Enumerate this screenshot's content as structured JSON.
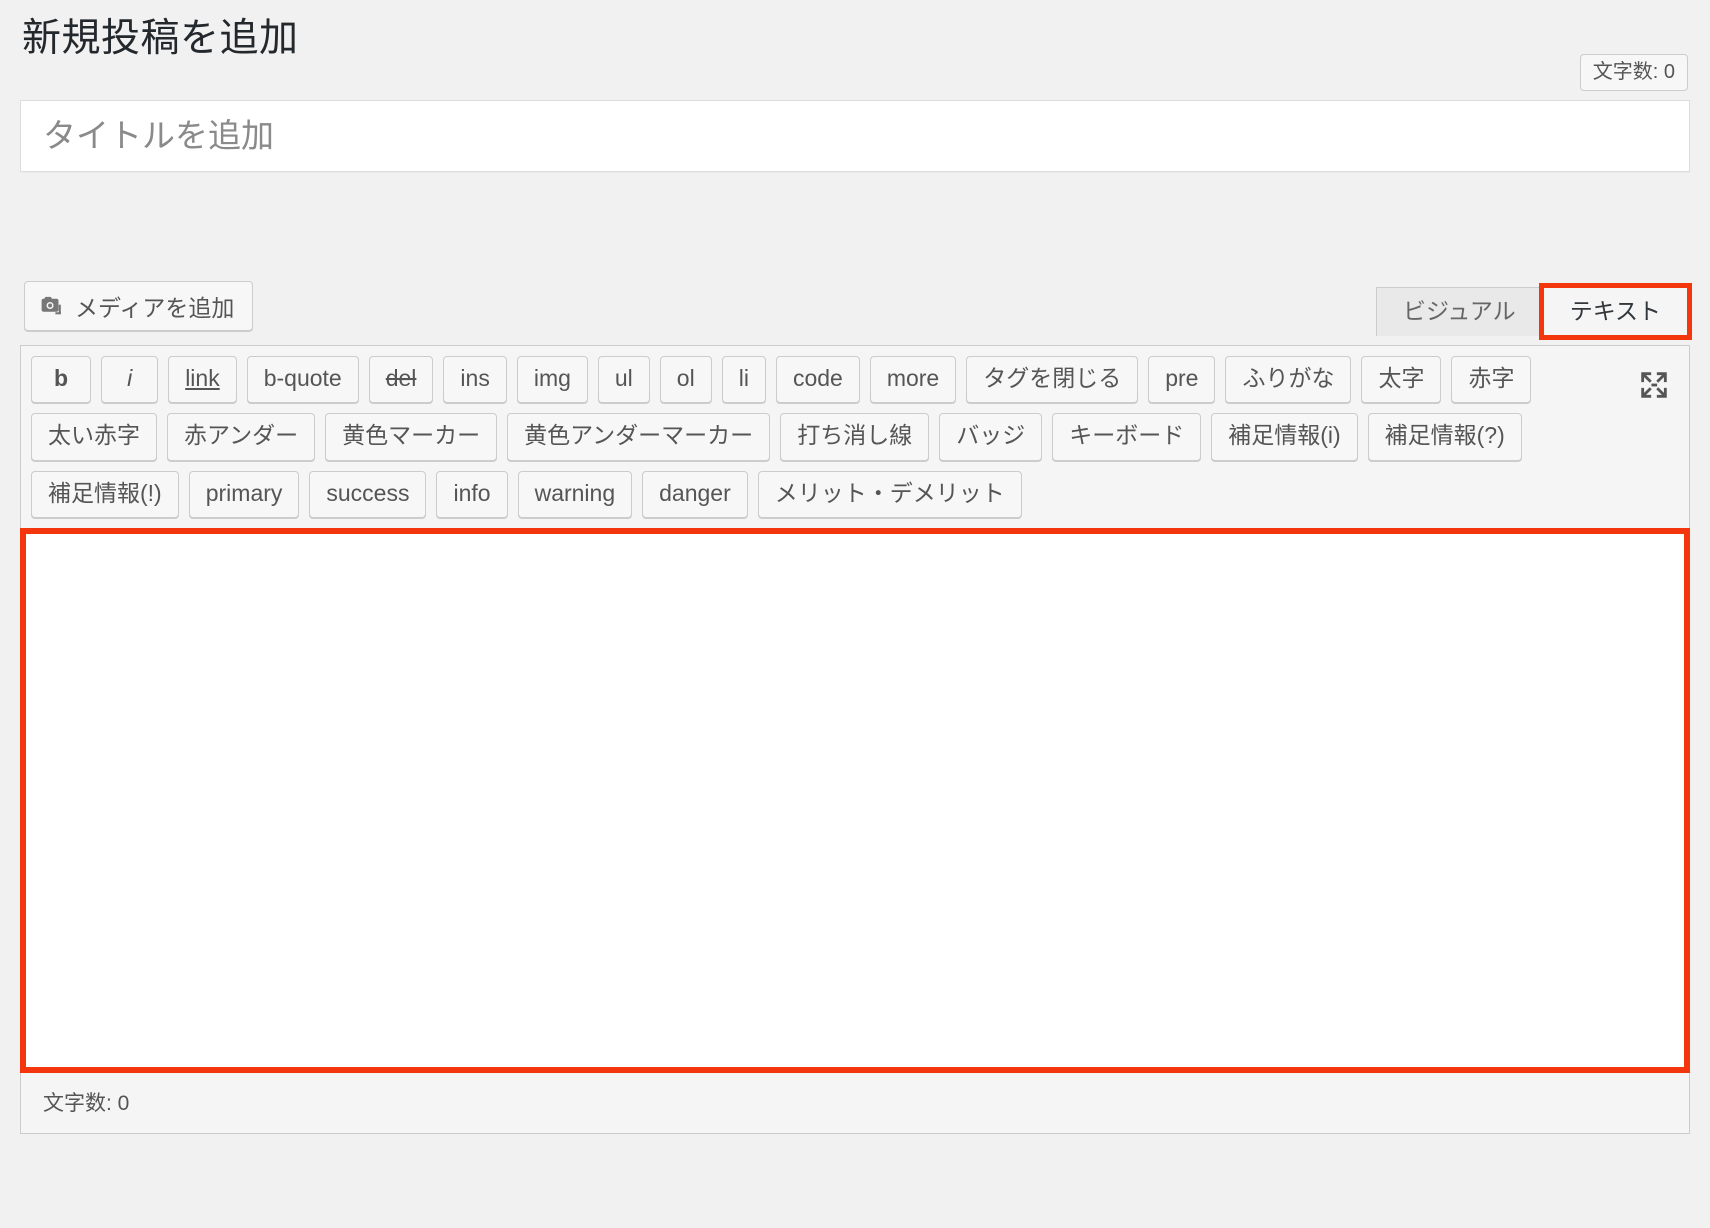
{
  "header": {
    "title": "新規投稿を追加",
    "char_count_badge": "文字数: 0"
  },
  "title_field": {
    "placeholder": "タイトルを追加",
    "value": ""
  },
  "media": {
    "add_media_label": "メディアを追加",
    "icon": "camera-media-icon"
  },
  "tabs": [
    {
      "label": "ビジュアル",
      "active": false
    },
    {
      "label": "テキスト",
      "active": true
    }
  ],
  "toolbar": {
    "fullscreen_icon": "fullscreen-expand-icon",
    "rows": [
      [
        {
          "label": "b",
          "style": "b"
        },
        {
          "label": "i",
          "style": "i"
        },
        {
          "label": "link",
          "style": "link"
        },
        {
          "label": "b-quote",
          "style": ""
        },
        {
          "label": "del",
          "style": "del"
        },
        {
          "label": "ins",
          "style": ""
        },
        {
          "label": "img",
          "style": ""
        },
        {
          "label": "ul",
          "style": ""
        },
        {
          "label": "ol",
          "style": ""
        },
        {
          "label": "li",
          "style": ""
        },
        {
          "label": "code",
          "style": ""
        },
        {
          "label": "more",
          "style": ""
        },
        {
          "label": "タグを閉じる",
          "style": ""
        },
        {
          "label": "pre",
          "style": ""
        },
        {
          "label": "ふりがな",
          "style": ""
        },
        {
          "label": "太字",
          "style": ""
        },
        {
          "label": "赤字",
          "style": ""
        }
      ],
      [
        {
          "label": "太い赤字",
          "style": ""
        },
        {
          "label": "赤アンダー",
          "style": ""
        },
        {
          "label": "黄色マーカー",
          "style": ""
        },
        {
          "label": "黄色アンダーマーカー",
          "style": ""
        },
        {
          "label": "打ち消し線",
          "style": ""
        },
        {
          "label": "バッジ",
          "style": ""
        },
        {
          "label": "キーボード",
          "style": ""
        },
        {
          "label": "補足情報(i)",
          "style": ""
        },
        {
          "label": "補足情報(?)",
          "style": ""
        }
      ],
      [
        {
          "label": "補足情報(!)",
          "style": ""
        },
        {
          "label": "primary",
          "style": ""
        },
        {
          "label": "success",
          "style": ""
        },
        {
          "label": "info",
          "style": ""
        },
        {
          "label": "warning",
          "style": ""
        },
        {
          "label": "danger",
          "style": ""
        },
        {
          "label": "メリット・デメリット",
          "style": ""
        }
      ]
    ]
  },
  "content": {
    "value": "",
    "placeholder": ""
  },
  "footer": {
    "char_count": "文字数: 0"
  },
  "colors": {
    "annotation": "#f4360f",
    "page_background": "#f1f1f1",
    "toolbar_background": "#f5f5f5",
    "button_face": "#f7f7f7",
    "border": "#cccccc",
    "text": "#555555",
    "heading": "#23282d"
  }
}
